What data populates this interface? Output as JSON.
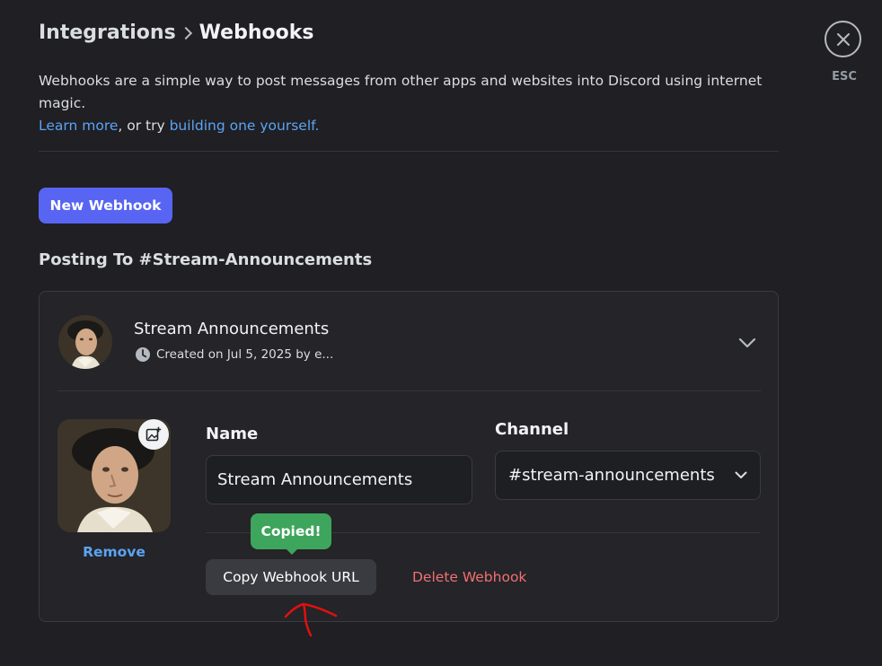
{
  "breadcrumb": {
    "parent": "Integrations",
    "current": "Webhooks"
  },
  "description": {
    "text": "Webhooks are a simple way to post messages from other apps and websites into Discord using internet magic.",
    "learn_more": "Learn more",
    "middle": ", or try ",
    "build_link": "building one yourself."
  },
  "close": {
    "icon": "close-icon",
    "label": "ESC"
  },
  "new_webhook_label": "New Webhook",
  "section_title": "Posting To #Stream-Announcements",
  "webhook": {
    "name": "Stream Announcements",
    "meta": "Created on Jul 5, 2025 by e...",
    "remove_label": "Remove",
    "name_label": "Name",
    "name_value": "Stream Announcements",
    "channel_label": "Channel",
    "channel_value": "#stream-announcements",
    "tooltip": "Copied!",
    "copy_label": "Copy Webhook URL",
    "delete_label": "Delete Webhook"
  },
  "colors": {
    "background": "#1f1f24",
    "card": "#242429",
    "blurple": "#5865f2",
    "link": "#5ba4f2",
    "danger": "#f0716f",
    "success": "#3ea55c",
    "annotation": "#e01010"
  }
}
